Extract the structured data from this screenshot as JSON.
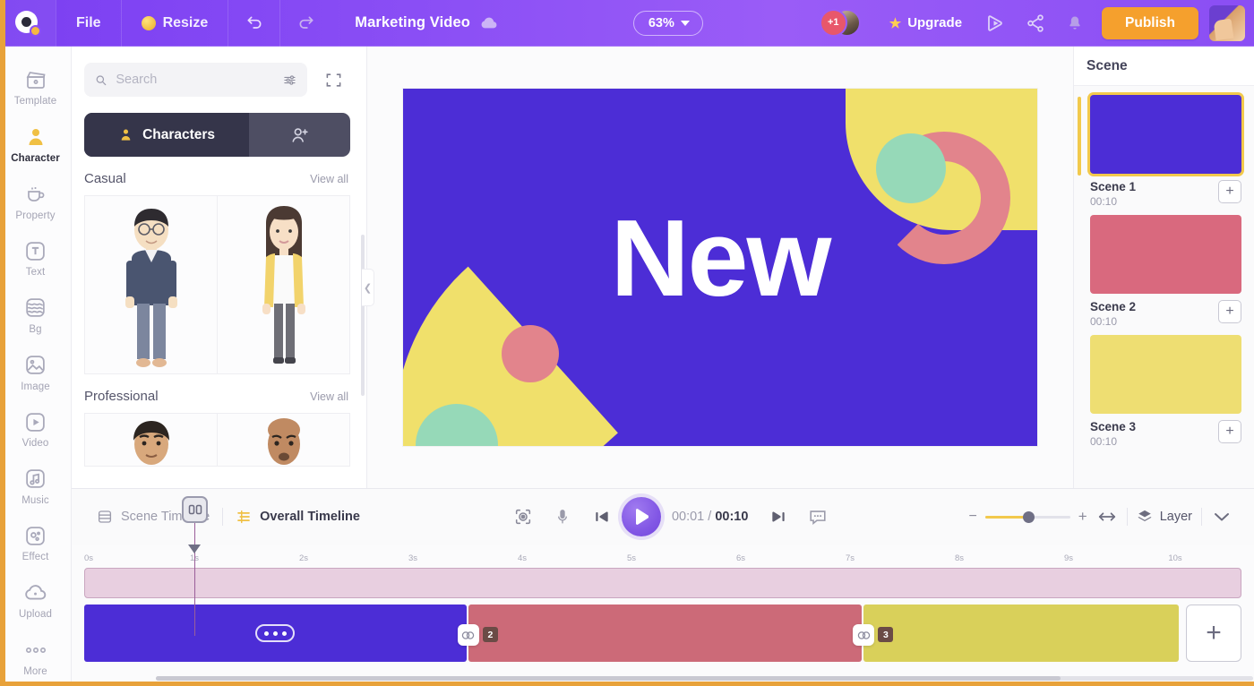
{
  "topbar": {
    "logo_icon": "animaker-logo-icon",
    "file_label": "File",
    "resize_label": "Resize",
    "undo_icon": "undo-icon",
    "redo_icon": "redo-icon",
    "project_title": "Marketing Video",
    "cloud_icon": "cloud-sync-icon",
    "zoom_level": "63%",
    "collaborator_badge": "+1",
    "upgrade_label": "Upgrade",
    "star_icon": "star-icon",
    "preview_icon": "preview-play-icon",
    "share_icon": "share-icon",
    "notification_icon": "bell-icon",
    "publish_label": "Publish",
    "profile_icon": "user-avatar"
  },
  "rail": {
    "items": [
      {
        "label": "Template",
        "icon": "template-icon",
        "active": false
      },
      {
        "label": "Character",
        "icon": "character-icon",
        "active": true
      },
      {
        "label": "Property",
        "icon": "property-cup-icon",
        "active": false
      },
      {
        "label": "Text",
        "icon": "text-icon",
        "active": false
      },
      {
        "label": "Bg",
        "icon": "background-icon",
        "active": false
      },
      {
        "label": "Image",
        "icon": "image-icon",
        "active": false
      },
      {
        "label": "Video",
        "icon": "video-icon",
        "active": false
      },
      {
        "label": "Music",
        "icon": "music-icon",
        "active": false
      },
      {
        "label": "Effect",
        "icon": "effect-icon",
        "active": false
      },
      {
        "label": "Upload",
        "icon": "upload-cloud-icon",
        "active": false
      },
      {
        "label": "More",
        "icon": "more-dots-icon",
        "active": false
      }
    ]
  },
  "library": {
    "search_placeholder": "Search",
    "search_value": "",
    "search_icon": "search-icon",
    "filter_icon": "sliders-filter-icon",
    "expand_icon": "expand-fullscreen-icon",
    "tab_characters": "Characters",
    "tab_add_character_icon": "add-person-icon",
    "sections": [
      {
        "title": "Casual",
        "view_all": "View all"
      },
      {
        "title": "Professional",
        "view_all": "View all"
      }
    ],
    "collapse_icon": "chevron-left-icon"
  },
  "canvas": {
    "text": "New",
    "background_color": "#4c2dd6",
    "shapes": {
      "yellow": "#f0e06b",
      "pink": "#e2848c",
      "mint": "#96d9b8",
      "text_color": "#ffffff"
    }
  },
  "scene_panel": {
    "title": "Scene",
    "add_icon": "plus-icon",
    "scenes": [
      {
        "name": "Scene 1",
        "duration": "00:10",
        "color": "#4c2dd6",
        "selected": true
      },
      {
        "name": "Scene 2",
        "duration": "00:10",
        "color": "#d9697e",
        "selected": false
      },
      {
        "name": "Scene 3",
        "duration": "00:10",
        "color": "#eede72",
        "selected": false
      }
    ]
  },
  "timeline": {
    "tab_scene": "Scene Timeline",
    "tab_overall": "Overall Timeline",
    "scene_tab_icon": "scene-timeline-icon",
    "overall_tab_icon": "overall-timeline-icon",
    "record_icon": "record-target-icon",
    "mic_icon": "microphone-icon",
    "prev_icon": "skip-previous-icon",
    "play_icon": "play-icon",
    "next_icon": "skip-next-icon",
    "caption_icon": "caption-bubble-icon",
    "current_time": "00:01",
    "separator": "/",
    "total_time": "00:10",
    "zoom_minus": "−",
    "zoom_plus": "+",
    "fit_icon": "fit-width-icon",
    "layer_label": "Layer",
    "layer_icon": "layers-icon",
    "chevron_icon": "chevron-down-icon",
    "ruler_ticks": [
      "0s",
      "1s",
      "2s",
      "3s",
      "4s",
      "5s",
      "6s",
      "7s",
      "8s",
      "9s",
      "10s"
    ],
    "playhead_position": "1s",
    "playhead_icon": "playhead-handle-icon",
    "clips": [
      {
        "color": "#4c2dd6",
        "flex": 34,
        "badge": "",
        "has_dots": true,
        "link_icon": ""
      },
      {
        "color": "#cc6a78",
        "flex": 35,
        "badge": "2",
        "has_dots": false,
        "link_icon": "link-transition-icon"
      },
      {
        "color": "#d9d05a",
        "flex": 28,
        "badge": "3",
        "has_dots": false,
        "link_icon": "link-transition-icon"
      }
    ],
    "add_clip_label": "+"
  }
}
